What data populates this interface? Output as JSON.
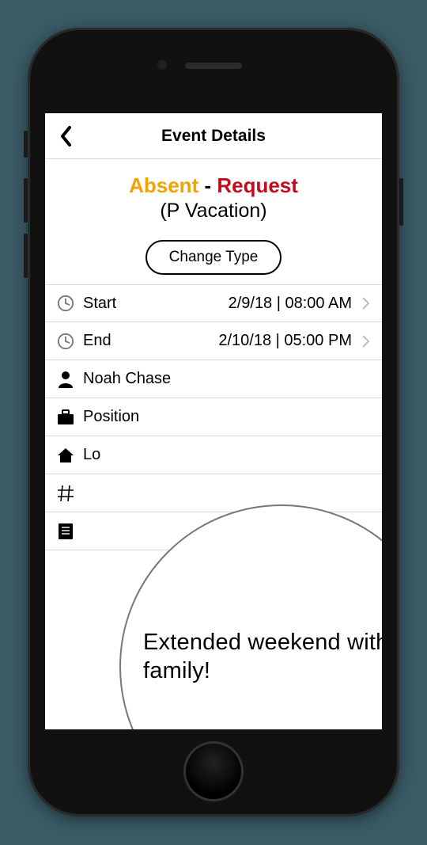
{
  "navbar": {
    "title": "Event Details"
  },
  "headline": {
    "absent": "Absent",
    "separator": "-",
    "request": "Request",
    "subtitle": "(P Vacation)"
  },
  "change_type_label": "Change Type",
  "rows": {
    "start": {
      "label": "Start",
      "value": "2/9/18 | 08:00 AM"
    },
    "end": {
      "label": "End",
      "value": "2/10/18 | 05:00 PM"
    },
    "person": {
      "label": "Noah Chase"
    },
    "position": {
      "label": "Position"
    },
    "location": {
      "label": "Lo"
    },
    "number": {
      "label": ""
    },
    "notes": {
      "label": ""
    }
  },
  "magnifier": {
    "note": "Extended weekend with the family!"
  }
}
